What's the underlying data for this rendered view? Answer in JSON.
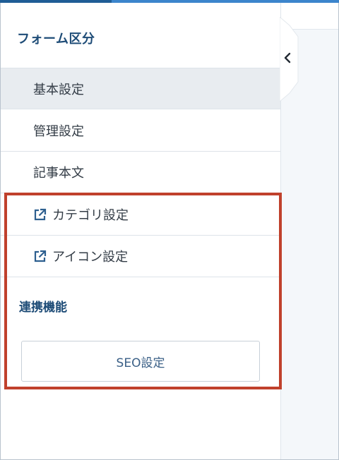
{
  "sidebar": {
    "title": "フォーム区分",
    "items": [
      {
        "label": "基本設定",
        "active": true,
        "external": false
      },
      {
        "label": "管理設定",
        "active": false,
        "external": false
      },
      {
        "label": "記事本文",
        "active": false,
        "external": false
      },
      {
        "label": "カテゴリ設定",
        "active": false,
        "external": true,
        "icon": "external-link-icon"
      },
      {
        "label": "アイコン設定",
        "active": false,
        "external": true,
        "icon": "external-link-icon"
      }
    ],
    "integration_section_label": "連携機能",
    "seo_button_label": "SEO設定",
    "collapse_icon": "chevron-left-icon"
  },
  "colors": {
    "heading": "#1e4c77",
    "highlight": "#c0412c",
    "active_item_bg": "#e8ecf0",
    "top_bar_dark": "#1f5d96",
    "top_bar_light": "#3c85cc"
  }
}
